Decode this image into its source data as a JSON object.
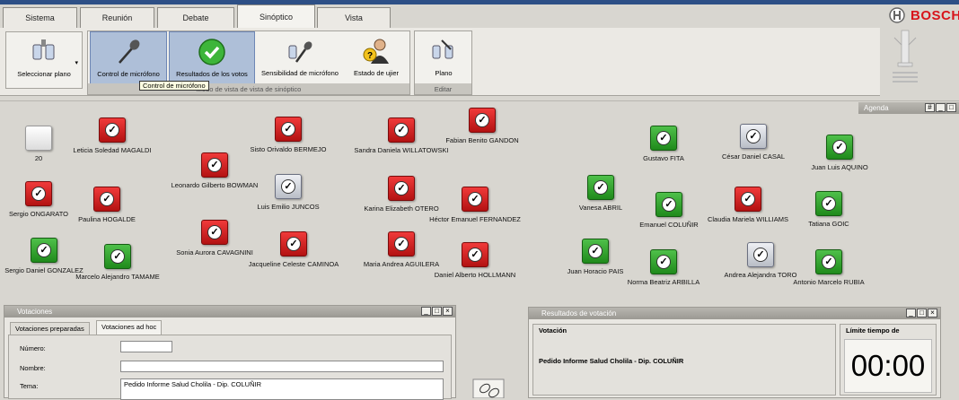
{
  "tabs": [
    {
      "label": "Sistema",
      "active": false
    },
    {
      "label": "Reunión",
      "active": false
    },
    {
      "label": "Debate",
      "active": false
    },
    {
      "label": "Sinóptico",
      "active": true
    },
    {
      "label": "Vista",
      "active": false
    }
  ],
  "brand": {
    "name": "BOSCH",
    "color": "#d8141b"
  },
  "toolbar": {
    "select_plan": "Seleccionar plano",
    "mic_control": "Control de micrófono",
    "vote_results": "Resultados de los votos",
    "mic_sensitivity": "Sensibilidad de micrófono",
    "user_status": "Estado de ujier",
    "group1_footer": "Modo de vista de vista de sinóptico",
    "plan": "Plano",
    "group2_footer": "Editar",
    "tooltip": "Control de micrófono"
  },
  "agenda": {
    "title": "Agenda"
  },
  "seats": [
    {
      "name": "20",
      "status": "white"
    },
    {
      "name": "Leticia Soledad MAGALDI",
      "status": "red"
    },
    {
      "name": "Sisto Orivaldo BERMEJO",
      "status": "red"
    },
    {
      "name": "Sandra Daniela WILLATOWSKI",
      "status": "red"
    },
    {
      "name": "Fabian Benito GANDON",
      "status": "red"
    },
    {
      "name": "Leonardo Gilberto BOWMAN",
      "status": "red"
    },
    {
      "name": "Sergio ONGARATO",
      "status": "red"
    },
    {
      "name": "Paulina HOGALDE",
      "status": "red"
    },
    {
      "name": "Luis Emilio JUNCOS",
      "status": "gray"
    },
    {
      "name": "Karina Elizabeth OTERO",
      "status": "red"
    },
    {
      "name": "Héctor Emanuel FERNANDEZ",
      "status": "red"
    },
    {
      "name": "Sergio Daniel GONZALEZ",
      "status": "green"
    },
    {
      "name": "Marcelo Alejandro TAMAME",
      "status": "green"
    },
    {
      "name": "Sonia Aurora CAVAGNINI",
      "status": "red"
    },
    {
      "name": "Jacqueline Celeste CAMINOA",
      "status": "red"
    },
    {
      "name": "Maria Andrea AGUILERA",
      "status": "red"
    },
    {
      "name": "Daniel Alberto HOLLMANN",
      "status": "red"
    },
    {
      "name": "Gustavo FITA",
      "status": "green"
    },
    {
      "name": "César Daniel CASAL",
      "status": "gray"
    },
    {
      "name": "Juan Luis AQUINO",
      "status": "green"
    },
    {
      "name": "Vanesa ABRIL",
      "status": "green"
    },
    {
      "name": "Emanuel COLUÑIR",
      "status": "green"
    },
    {
      "name": "Claudia Mariela WILLIAMS",
      "status": "red"
    },
    {
      "name": "Tatiana GOIC",
      "status": "green"
    },
    {
      "name": "Juan Horacio PAIS",
      "status": "green"
    },
    {
      "name": "Norma Beatriz ARBILLA",
      "status": "green"
    },
    {
      "name": "Andrea Alejandra TORO",
      "status": "gray"
    },
    {
      "name": "Antonio Marcelo RUBIA",
      "status": "green"
    }
  ],
  "votaciones": {
    "title": "Votaciones",
    "tab_prepared": "Votaciones preparadas",
    "tab_adhoc": "Votaciones ad hoc",
    "numero_label": "Número:",
    "numero_value": "",
    "nombre_label": "Nombre:",
    "nombre_value": "",
    "tema_label": "Tema:",
    "tema_value": "Pedido Informe Salud Cholila - Dip. COLUÑIR"
  },
  "results": {
    "title": "Resultados de votación",
    "votacion_label": "Votación",
    "votacion_value": "Pedido Informe Salud Cholila - Dip. COLUÑIR",
    "time_limit_label": "Límite tiempo de",
    "time_value": "00:00"
  },
  "colors": {
    "red": "#d42020",
    "green": "#2ea02a",
    "accent": "#aebfd8"
  }
}
